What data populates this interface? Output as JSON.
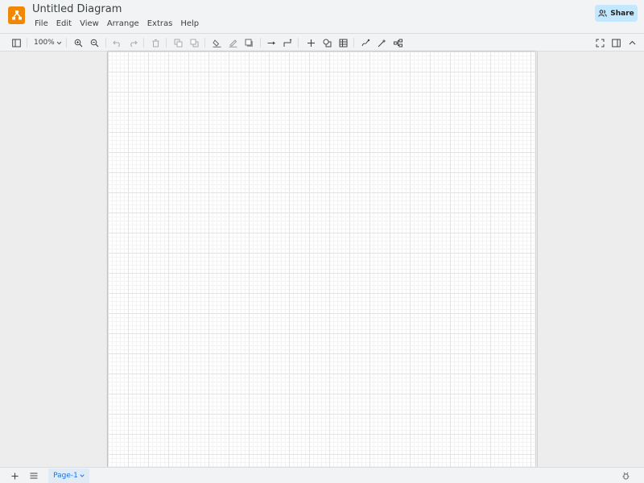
{
  "app": {
    "title": "Untitled Diagram",
    "accent_color": "#f08705",
    "logo_icon": "drawio-logo-icon"
  },
  "menu": {
    "items": [
      "File",
      "Edit",
      "View",
      "Arrange",
      "Extras",
      "Help"
    ]
  },
  "share": {
    "label": "Share",
    "bg_color": "#c2e7ff"
  },
  "toolbar": {
    "zoom_value": "100%",
    "tools": [
      "sidebar-toggle-icon",
      "zoom-in-icon",
      "zoom-out-icon",
      "undo-icon",
      "redo-icon",
      "delete-icon",
      "to-front-icon",
      "to-back-icon",
      "fill-color-icon",
      "line-color-icon",
      "shadow-icon",
      "connection-icon",
      "waypoints-icon",
      "insert-icon",
      "shapes-icon",
      "table-icon",
      "freehand-icon",
      "magic-icon",
      "layout-icon",
      "fullscreen-icon",
      "format-panel-icon",
      "collapse-icon"
    ]
  },
  "footer": {
    "page_tab": "Page-1",
    "add_icon": "plus-icon",
    "pages_icon": "menu-icon",
    "right_icon": "bug-icon"
  }
}
